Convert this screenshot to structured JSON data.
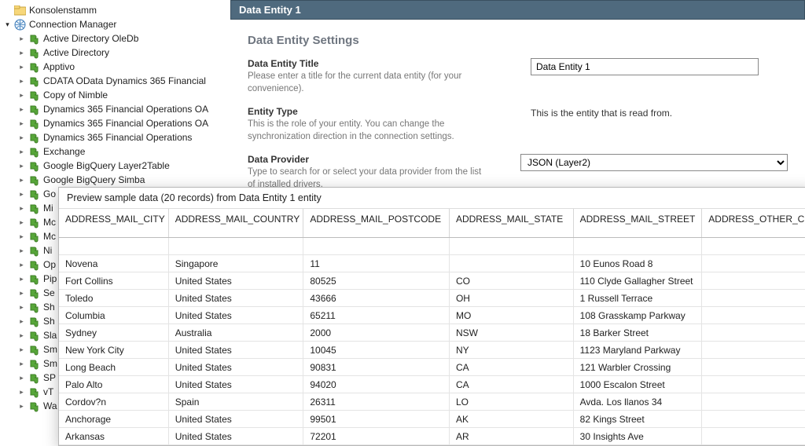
{
  "tree": {
    "root": "Konsolenstamm",
    "manager": "Connection Manager",
    "items_full": [
      "Active Directory OleDb",
      "Active Directory",
      "Apptivo",
      "CDATA OData Dynamics 365 Financial",
      "Copy of Nimble",
      "Dynamics 365 Financial Operations OA",
      "Dynamics 365 Financial Operations OA",
      "Dynamics 365 Financial Operations",
      "Exchange",
      "Google BigQuery Layer2Table",
      "Google BigQuery Simba"
    ],
    "items_cut": [
      "Go",
      "Mi",
      "Mc",
      "Mc",
      "Ni",
      "Op",
      "Pip",
      "Se",
      "Sh",
      "Sh",
      "Sla",
      "Sm",
      "Sm",
      "SP",
      "vT",
      "Wa"
    ]
  },
  "panel": {
    "header": "Data Entity 1",
    "settings_title": "Data Entity Settings",
    "field_title": {
      "label": "Data Entity Title",
      "help": "Please enter a title for the current data entity (for your convenience).",
      "value": "Data Entity 1"
    },
    "field_type": {
      "label": "Entity Type",
      "help": "This is the role of your entity. You can change the synchronization direction in the connection settings.",
      "value": "This is the entity that is read from."
    },
    "field_provider": {
      "label": "Data Provider",
      "help": "Type to search for or select your data provider from the list of installed drivers.",
      "value": "JSON (Layer2)"
    }
  },
  "preview": {
    "title": "Preview sample data (20 records) from Data Entity 1 entity",
    "columns": [
      "ADDRESS_MAIL_CITY",
      "ADDRESS_MAIL_COUNTRY",
      "ADDRESS_MAIL_POSTCODE",
      "ADDRESS_MAIL_STATE",
      "ADDRESS_MAIL_STREET",
      "ADDRESS_OTHER_CITY"
    ],
    "rows": [
      [
        "",
        "",
        "",
        "",
        "",
        ""
      ],
      [
        "Novena",
        "Singapore",
        "11",
        "",
        "10 Eunos Road 8",
        ""
      ],
      [
        "Fort Collins",
        "United States",
        "80525",
        "CO",
        "110 Clyde Gallagher Street",
        ""
      ],
      [
        "Toledo",
        "United States",
        "43666",
        "OH",
        "1 Russell Terrace",
        ""
      ],
      [
        "Columbia",
        "United States",
        "65211",
        "MO",
        "108 Grasskamp Parkway",
        ""
      ],
      [
        "Sydney",
        "Australia",
        "2000",
        "NSW",
        "18 Barker Street",
        ""
      ],
      [
        "New York City",
        "United States",
        "10045",
        "NY",
        "1123 Maryland Parkway",
        ""
      ],
      [
        "Long Beach",
        "United States",
        "90831",
        "CA",
        "121 Warbler Crossing",
        ""
      ],
      [
        "Palo Alto",
        "United States",
        "94020",
        "CA",
        "1000 Escalon Street",
        ""
      ],
      [
        "Cordov?n",
        "Spain",
        "26311",
        "LO",
        "Avda. Los llanos 34",
        ""
      ],
      [
        "Anchorage",
        "United States",
        "99501",
        "AK",
        "82 Kings Street",
        ""
      ],
      [
        "Arkansas",
        "United States",
        "72201",
        "AR",
        "30 Insights Ave",
        ""
      ]
    ]
  }
}
